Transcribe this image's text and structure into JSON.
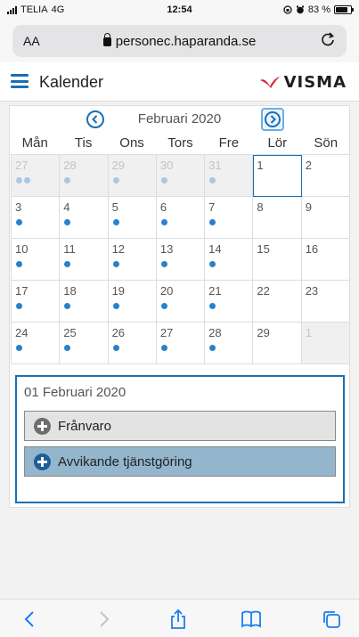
{
  "status_bar": {
    "carrier": "TELIA",
    "network": "4G",
    "time": "12:54",
    "battery": "83 %",
    "battery_level": 0.83
  },
  "address_bar": {
    "text_size_label": "AA",
    "url": "personec.haparanda.se",
    "icons": [
      "lock-icon",
      "reload-icon"
    ]
  },
  "header": {
    "title": "Kalender",
    "logo": "VISMA",
    "brand_color": "#d9232e",
    "accent_color": "#1a6fb3"
  },
  "calendar": {
    "month_label": "Februari 2020",
    "weekdays": [
      "Mån",
      "Tis",
      "Ons",
      "Tors",
      "Fre",
      "Lör",
      "Sön"
    ],
    "weeks": [
      [
        {
          "day": "27",
          "other": true,
          "dots": [
            "grey",
            "blue"
          ]
        },
        {
          "day": "28",
          "other": true,
          "dots": [
            "blue"
          ]
        },
        {
          "day": "29",
          "other": true,
          "dots": [
            "blue"
          ]
        },
        {
          "day": "30",
          "other": true,
          "dots": [
            "blue"
          ]
        },
        {
          "day": "31",
          "other": true,
          "dots": [
            "blue"
          ]
        },
        {
          "day": "1",
          "other": false,
          "selected": true,
          "dots": []
        },
        {
          "day": "2",
          "other": false,
          "dots": []
        }
      ],
      [
        {
          "day": "3",
          "dots": [
            "blue"
          ]
        },
        {
          "day": "4",
          "dots": [
            "blue"
          ]
        },
        {
          "day": "5",
          "dots": [
            "blue"
          ]
        },
        {
          "day": "6",
          "dots": [
            "blue"
          ]
        },
        {
          "day": "7",
          "dots": [
            "blue"
          ]
        },
        {
          "day": "8",
          "dots": []
        },
        {
          "day": "9",
          "dots": []
        }
      ],
      [
        {
          "day": "10",
          "dots": [
            "blue"
          ]
        },
        {
          "day": "11",
          "dots": [
            "blue"
          ]
        },
        {
          "day": "12",
          "dots": [
            "blue"
          ]
        },
        {
          "day": "13",
          "dots": [
            "blue"
          ]
        },
        {
          "day": "14",
          "dots": [
            "blue"
          ]
        },
        {
          "day": "15",
          "dots": []
        },
        {
          "day": "16",
          "dots": []
        }
      ],
      [
        {
          "day": "17",
          "dots": [
            "blue"
          ]
        },
        {
          "day": "18",
          "dots": [
            "blue"
          ]
        },
        {
          "day": "19",
          "dots": [
            "blue"
          ]
        },
        {
          "day": "20",
          "dots": [
            "blue"
          ]
        },
        {
          "day": "21",
          "dots": [
            "blue"
          ]
        },
        {
          "day": "22",
          "dots": []
        },
        {
          "day": "23",
          "dots": []
        }
      ],
      [
        {
          "day": "24",
          "dots": [
            "blue"
          ]
        },
        {
          "day": "25",
          "dots": [
            "blue"
          ]
        },
        {
          "day": "26",
          "dots": [
            "blue"
          ]
        },
        {
          "day": "27",
          "dots": [
            "blue"
          ]
        },
        {
          "day": "28",
          "dots": [
            "blue"
          ]
        },
        {
          "day": "29",
          "dots": []
        },
        {
          "day": "1",
          "other": true,
          "dots": []
        }
      ]
    ]
  },
  "detail": {
    "date": "01 Februari 2020",
    "buttons": [
      {
        "label": "Frånvaro"
      },
      {
        "label": "Avvikande tjänstgöring"
      }
    ]
  },
  "toolbar": {
    "icons": [
      "back-icon",
      "forward-icon",
      "share-icon",
      "bookmarks-icon",
      "tabs-icon"
    ]
  }
}
